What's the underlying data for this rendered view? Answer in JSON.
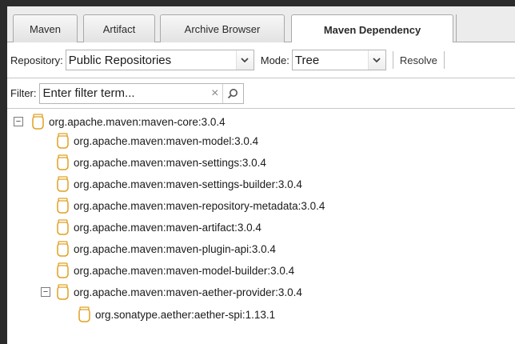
{
  "tabs": [
    {
      "label": "Maven",
      "active": false
    },
    {
      "label": "Artifact",
      "active": false
    },
    {
      "label": "Archive Browser",
      "active": false
    },
    {
      "label": "Maven Dependency",
      "active": true
    }
  ],
  "toolbar": {
    "repository_label": "Repository:",
    "repository_value": "Public Repositories",
    "mode_label": "Mode:",
    "mode_value": "Tree",
    "resolve_label": "Resolve"
  },
  "filter": {
    "label": "Filter:",
    "placeholder": "Enter filter term...",
    "value": ""
  },
  "tree": {
    "root": {
      "label": "org.apache.maven:maven-core:3.0.4",
      "expanded": true
    },
    "children": [
      {
        "label": "org.apache.maven:maven-model:3.0.4"
      },
      {
        "label": "org.apache.maven:maven-settings:3.0.4"
      },
      {
        "label": "org.apache.maven:maven-settings-builder:3.0.4"
      },
      {
        "label": "org.apache.maven:maven-repository-metadata:3.0.4"
      },
      {
        "label": "org.apache.maven:maven-artifact:3.0.4"
      },
      {
        "label": "org.apache.maven:maven-plugin-api:3.0.4"
      },
      {
        "label": "org.apache.maven:maven-model-builder:3.0.4"
      },
      {
        "label": "org.apache.maven:maven-aether-provider:3.0.4",
        "expanded": true
      }
    ],
    "grandchildren": [
      {
        "label": "org.sonatype.aether:aether-spi:1.13.1"
      }
    ]
  },
  "icons": {
    "jar": "jar-icon",
    "collapse": "collapse-icon",
    "chevron": "chevron-down-icon",
    "clear": "clear-icon",
    "search": "search-icon"
  }
}
